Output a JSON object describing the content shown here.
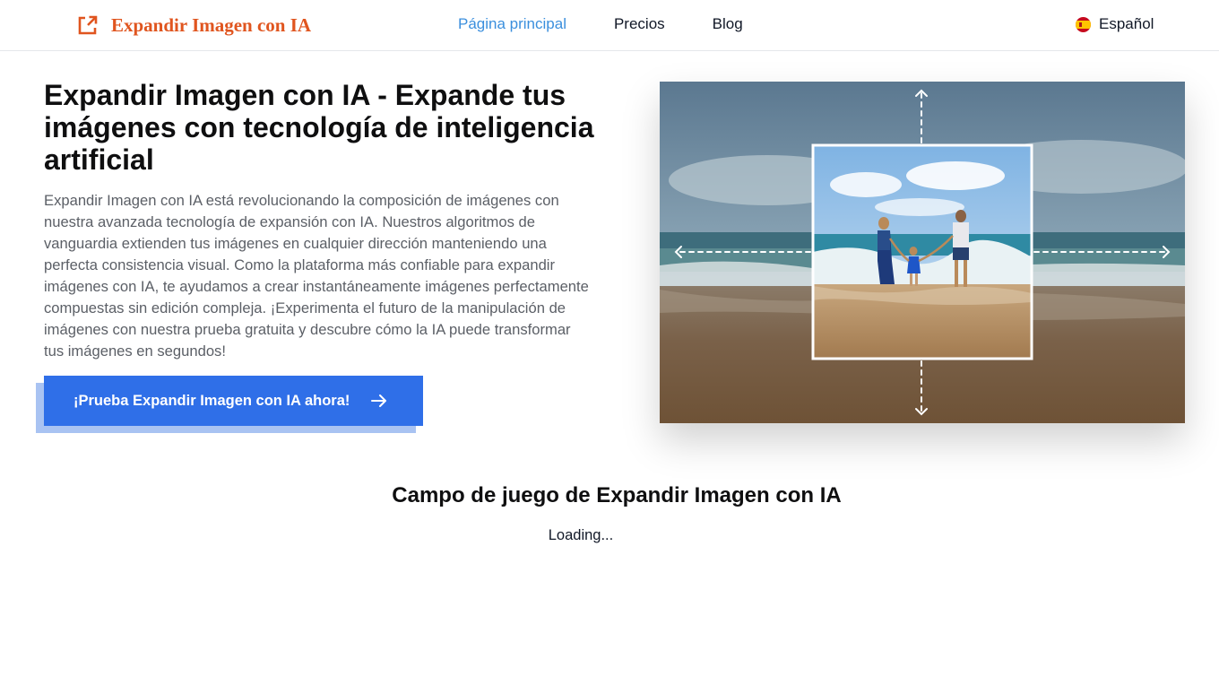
{
  "header": {
    "brand_name": "Expandir Imagen con IA",
    "nav": {
      "home": "Página principal",
      "pricing": "Precios",
      "blog": "Blog"
    },
    "language": "Español"
  },
  "hero": {
    "title": "Expandir Imagen con IA - Expande tus imágenes con tecnología de inteligencia artificial",
    "description": "Expandir Imagen con IA está revolucionando la composición de imágenes con nuestra avanzada tecnología de expansión con IA. Nuestros algoritmos de vanguardia extienden tus imágenes en cualquier dirección manteniendo una perfecta consistencia visual. Como la plataforma más confiable para expandir imágenes con IA, te ayudamos a crear instantáneamente imágenes perfectamente compuestas sin edición compleja. ¡Experimenta el futuro de la manipulación de imágenes con nuestra prueba gratuita y descubre cómo la IA puede transformar tus imágenes en segundos!",
    "cta_label": "¡Prueba Expandir Imagen con IA ahora!"
  },
  "playground": {
    "title": "Campo de juego de Expandir Imagen con IA",
    "status": "Loading..."
  },
  "icons": {
    "brand": "external-link-icon",
    "cta": "arrow-right-icon",
    "language": "spain-flag-icon"
  },
  "colors": {
    "brand": "#e0551f",
    "nav_active": "#3b8fdd",
    "cta": "#2f6fe8",
    "cta_shadow": "#a9c3f2"
  }
}
